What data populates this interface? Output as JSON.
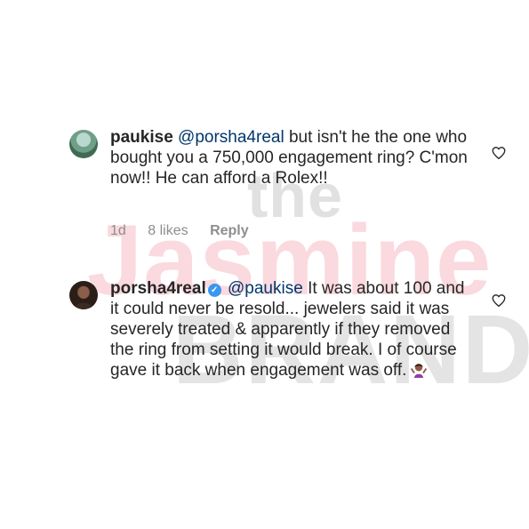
{
  "watermark": {
    "line1": "the",
    "line2": "Jasmine",
    "line3": "BRAND"
  },
  "comments": [
    {
      "username": "paukise",
      "mention": "@porsha4real",
      "text": " but isn't he the one who bought you a 750,000 engagement ring? C'mon now!! He can afford a Rolex!!",
      "time": "1d",
      "likes": "8 likes",
      "reply": "Reply",
      "verified": false,
      "heart_icon": "heart-outline-icon",
      "avatar_icon": "landscape-avatar"
    },
    {
      "username": "porsha4real",
      "mention": "@paukise",
      "text": " It was about 100 and it could never be resold... jewelers said it was severely treated & apparently if they removed the ring from setting it would break. I of course gave it back when engagement was off.",
      "emoji": "woman-shrugging-emoji",
      "verified": true,
      "verified_icon": "verified-badge-icon",
      "heart_icon": "heart-outline-icon",
      "avatar_icon": "profile-photo-avatar"
    }
  ],
  "colors": {
    "text": "#262626",
    "mention": "#00376b",
    "meta": "#8e8e8e",
    "verified": "#3897f0"
  }
}
